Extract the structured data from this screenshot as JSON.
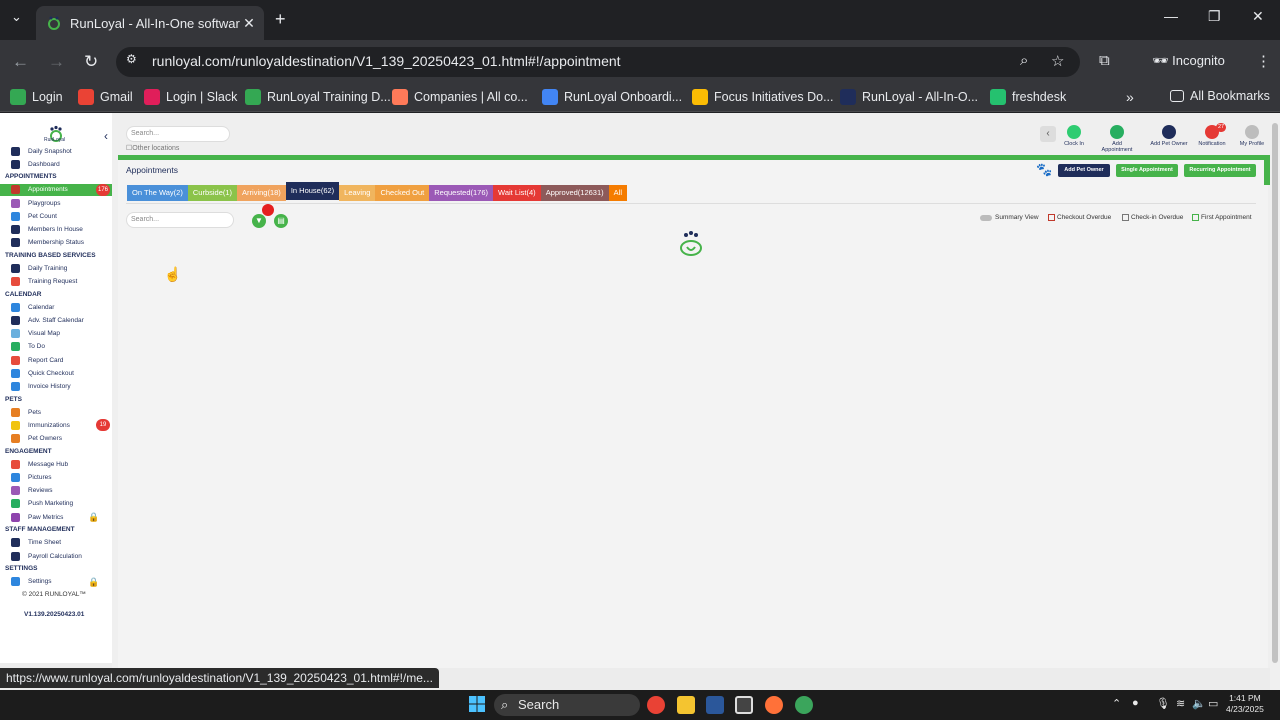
{
  "browser": {
    "tab_title": "RunLoyal - All-In-One software",
    "url": "runloyal.com/runloyaldestination/V1_139_20250423_01.html#!/appointment",
    "incognito_label": "Incognito",
    "bookmarks": [
      {
        "label": "Login",
        "color": "#34a853"
      },
      {
        "label": "Gmail",
        "color": "#ea4335"
      },
      {
        "label": "Login | Slack",
        "color": "#e01e5a"
      },
      {
        "label": "RunLoyal Training D...",
        "color": "#34a853"
      },
      {
        "label": "Companies | All co...",
        "color": "#ff7a59"
      },
      {
        "label": "RunLoyal Onboardi...",
        "color": "#4285f4"
      },
      {
        "label": "Focus Initiatives Do...",
        "color": "#fbbc04"
      },
      {
        "label": "RunLoyal - All-In-O...",
        "color": "#1f2d5a"
      },
      {
        "label": "freshdesk",
        "color": "#25c16f"
      }
    ],
    "all_bookmarks": "All Bookmarks",
    "status_url": "https://www.runloyal.com/runloyaldestination/V1_139_20250423_01.html#!/me..."
  },
  "sidebar": {
    "logo_text": "RunLoyal",
    "items_top": [
      {
        "label": "Daily Snapshot",
        "color": "#1f2d5a"
      },
      {
        "label": "Dashboard",
        "color": "#1f2d5a"
      }
    ],
    "sections": [
      {
        "title": "APPOINTMENTS",
        "items": [
          {
            "label": "Appointments",
            "active": true,
            "badge": "176",
            "color": "#c0392b"
          },
          {
            "label": "Playgroups",
            "color": "#9b59b6"
          },
          {
            "label": "Pet Count",
            "color": "#2e86de"
          },
          {
            "label": "Members In House",
            "color": "#1f2d5a"
          },
          {
            "label": "Membership Status",
            "color": "#1f2d5a"
          }
        ]
      },
      {
        "title": "TRAINING BASED SERVICES",
        "items": [
          {
            "label": "Daily Training",
            "color": "#1f2d5a"
          },
          {
            "label": "Training Request",
            "color": "#e74c3c"
          }
        ]
      },
      {
        "title": "CALENDAR",
        "items": [
          {
            "label": "Calendar",
            "color": "#2e86de"
          },
          {
            "label": "Adv. Staff Calendar",
            "color": "#1f2d5a"
          },
          {
            "label": "Visual Map",
            "color": "#6ab0de"
          },
          {
            "label": "To Do",
            "color": "#27ae60"
          },
          {
            "label": "Report Card",
            "color": "#e74c3c"
          },
          {
            "label": "Quick Checkout",
            "color": "#2e86de"
          },
          {
            "label": "Invoice History",
            "color": "#2e86de"
          }
        ]
      },
      {
        "title": "PETS",
        "items": [
          {
            "label": "Pets",
            "color": "#e67e22"
          },
          {
            "label": "Immunizations",
            "badge": "19",
            "color": "#f1c40f"
          },
          {
            "label": "Pet Owners",
            "color": "#e67e22"
          }
        ]
      },
      {
        "title": "ENGAGEMENT",
        "items": [
          {
            "label": "Message Hub",
            "color": "#e74c3c"
          },
          {
            "label": "Pictures",
            "color": "#2e86de"
          },
          {
            "label": "Reviews",
            "color": "#9b59b6"
          },
          {
            "label": "Push Marketing",
            "color": "#27ae60"
          },
          {
            "label": "Paw Metrics",
            "color": "#8e44ad",
            "locked": true
          }
        ]
      },
      {
        "title": "STAFF MANAGEMENT",
        "items": [
          {
            "label": "Time Sheet",
            "color": "#1f2d5a"
          },
          {
            "label": "Payroll Calculation",
            "color": "#1f2d5a"
          }
        ]
      },
      {
        "title": "SETTINGS",
        "items": [
          {
            "label": "Settings",
            "color": "#2e86de",
            "locked": true
          }
        ]
      }
    ],
    "copyright": "© 2021  RUNLOYAL™",
    "version": "V1.139.20250423.01"
  },
  "header": {
    "search_placeholder": "Search...",
    "other_locations": "Other locations",
    "actions": [
      {
        "label": "Clock In",
        "color": "#2ecc71"
      },
      {
        "label": "Add Appointment",
        "color": "#27ae60"
      },
      {
        "label": "Add Pet Owner",
        "color": "#1f2d5a"
      },
      {
        "label": "Notification",
        "color": "#e53935",
        "badge": "27"
      },
      {
        "label": "My Profile",
        "color": "#bdbdbd"
      }
    ]
  },
  "panel": {
    "title": "Appointments",
    "buttons": {
      "add_pet_owner": "Add Pet Owner",
      "single": "Single Appointment",
      "recurring": "Recurring Appointment"
    },
    "status_tabs": [
      {
        "label": "On The Way(2)",
        "color": "#4a90d9"
      },
      {
        "label": "Curbside(1)",
        "color": "#8bc34a"
      },
      {
        "label": "Arriving(18)",
        "color": "#f0a35e"
      },
      {
        "label": "In House(62)",
        "color": "#1f2d5a",
        "active": true
      },
      {
        "label": "Leaving",
        "color": "#f0b55e"
      },
      {
        "label": "Checked Out",
        "color": "#f0a040"
      },
      {
        "label": "Requested(176)",
        "color": "#9b59b6"
      },
      {
        "label": "Wait List(4)",
        "color": "#e53935"
      },
      {
        "label": "Approved(12631)",
        "color": "#8d5a5a"
      },
      {
        "label": "All",
        "color": "#f57c00"
      }
    ],
    "search_placeholder": "Search...",
    "legend": {
      "summary_view": "Summary View",
      "checkout_overdue": "Checkout Overdue",
      "checkin_overdue": "Check-in Overdue",
      "first_appointment": "First Appointment"
    }
  },
  "taskbar": {
    "search_label": "Search",
    "time": "1:41 PM",
    "date": "4/23/2025"
  }
}
